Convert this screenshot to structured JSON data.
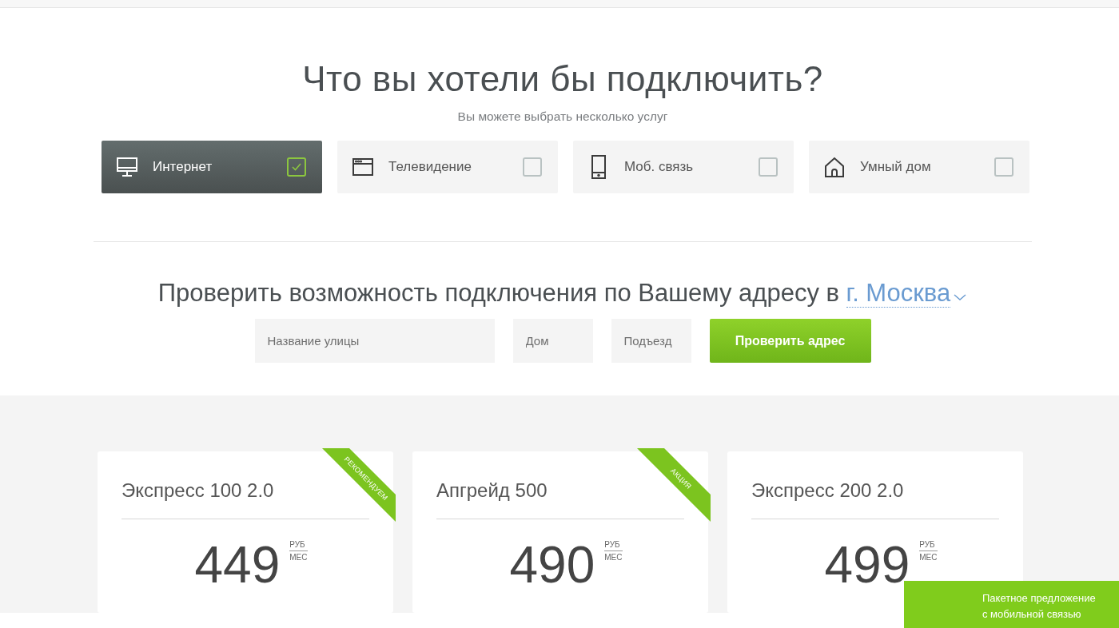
{
  "heading": "Что вы хотели бы подключить?",
  "subheading": "Вы можете выбрать несколько услуг",
  "services": [
    {
      "label": "Интернет",
      "kind": "internet",
      "checked": true
    },
    {
      "label": "Телевидение",
      "kind": "tv",
      "checked": false
    },
    {
      "label": "Моб. связь",
      "kind": "mobile",
      "checked": false
    },
    {
      "label": "Умный дом",
      "kind": "smarthome",
      "checked": false
    }
  ],
  "address_check": {
    "title": "Проверить возможность подключения по Вашему адресу в",
    "city": "г. Москва",
    "fields": [
      {
        "placeholder": "Название улицы"
      },
      {
        "placeholder": "Дом"
      },
      {
        "placeholder": "Подъезд"
      }
    ],
    "button": "Проверить адрес"
  },
  "tariffs": [
    {
      "name": "Экспресс 100 2.0",
      "price": "449",
      "currency": "РУБ",
      "period": "МЕС",
      "ribbon": "РЕКОМЕНДУЕМ"
    },
    {
      "name": "Апгрейд 500",
      "price": "490",
      "currency": "РУБ",
      "period": "МЕС",
      "ribbon": "АКЦИЯ"
    },
    {
      "name": "Экспресс 200 2.0",
      "price": "499",
      "currency": "РУБ",
      "period": "МЕС"
    }
  ],
  "bundle_offer": {
    "lines": [
      "Пакетное предложение",
      "с мобильной связью"
    ]
  }
}
